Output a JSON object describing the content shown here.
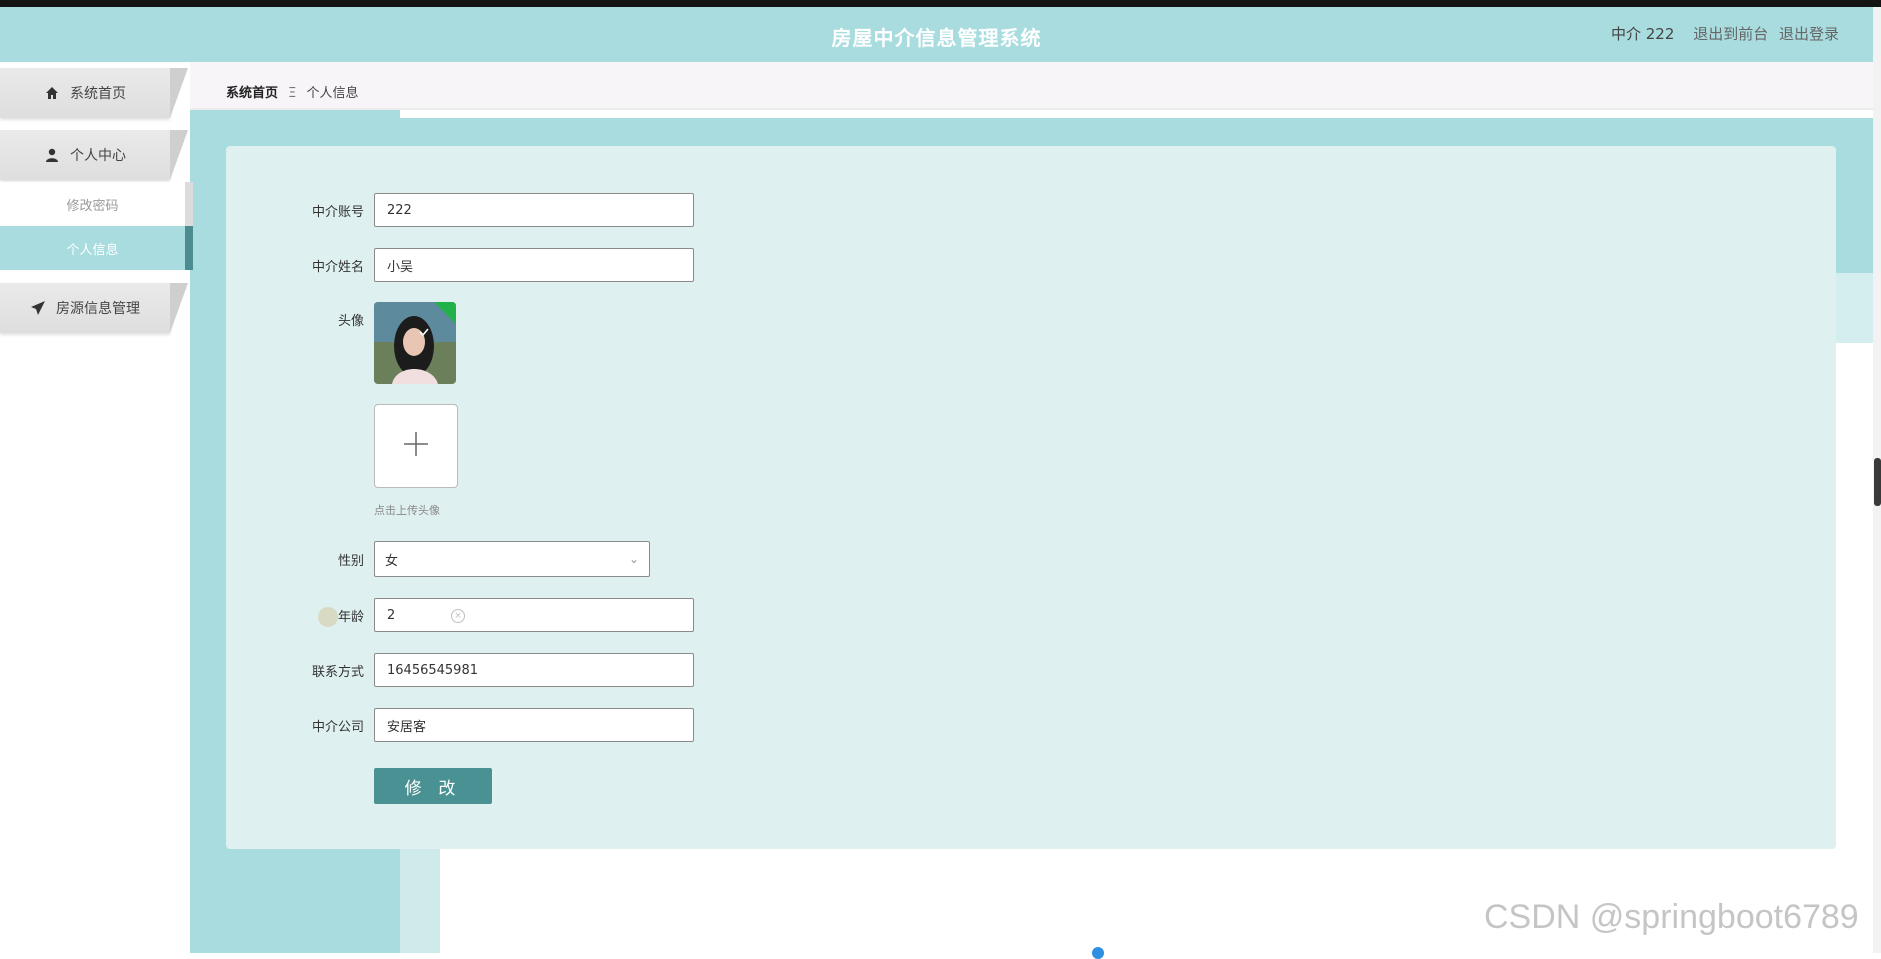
{
  "header": {
    "title": "房屋中介信息管理系统",
    "user_label": "中介 222",
    "links": [
      "退出到前台",
      "退出登录"
    ]
  },
  "sidebar": {
    "items": [
      {
        "label": "系统首页",
        "icon": "home-icon"
      },
      {
        "label": "个人中心",
        "icon": "user-icon"
      },
      {
        "label": "房源信息管理",
        "icon": "paper-plane-icon"
      }
    ],
    "sub_items": [
      {
        "label": "修改密码",
        "active": false
      },
      {
        "label": "个人信息",
        "active": true
      }
    ]
  },
  "breadcrumb": {
    "home": "系统首页",
    "separator": "Ξ",
    "current": "个人信息"
  },
  "form": {
    "account": {
      "label": "中介账号",
      "value": "222"
    },
    "name": {
      "label": "中介姓名",
      "value": "小吴"
    },
    "avatar": {
      "label": "头像",
      "hint": "点击上传头像"
    },
    "gender": {
      "label": "性别",
      "value": "女"
    },
    "age": {
      "label": "年龄",
      "value": "2"
    },
    "phone": {
      "label": "联系方式",
      "value": "16456545981"
    },
    "company": {
      "label": "中介公司",
      "value": "安居客"
    },
    "submit_label": "修 改"
  },
  "watermark": "CSDN @springboot6789",
  "colors": {
    "header_bg": "#a8dcde",
    "panel_bg": "#dff0f1",
    "button_bg": "#4a9194",
    "active_accent": "#4c8c91"
  }
}
